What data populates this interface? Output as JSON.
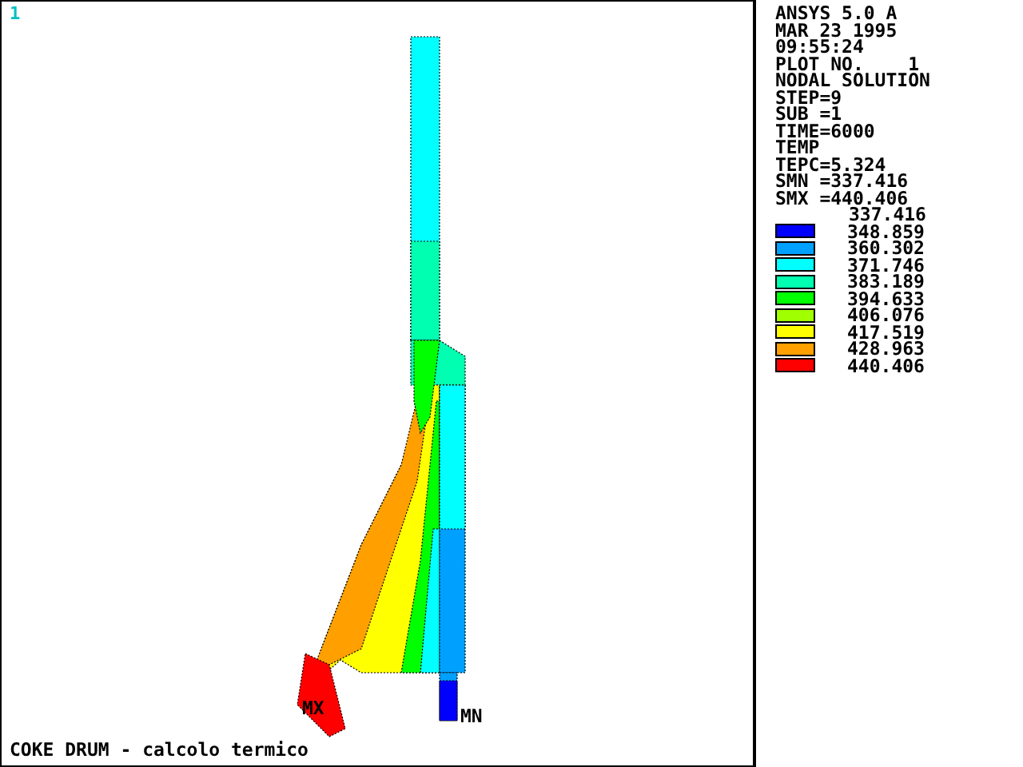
{
  "window": {
    "number": "1"
  },
  "plot": {
    "max_label": "MX",
    "min_label": "MN",
    "title": "COKE DRUM - calcolo termico"
  },
  "info": [
    "ANSYS 5.0 A",
    "MAR 23 1995",
    "09:55:24",
    "PLOT NO.    1",
    "NODAL SOLUTION",
    "STEP=9",
    "SUB =1",
    "TIME=6000",
    "TEMP",
    "TEPC=5.324",
    "SMN =337.416",
    "SMX =440.406"
  ],
  "legend": {
    "min": "337.416",
    "bands": [
      {
        "color": "#0000ff",
        "value": "348.859"
      },
      {
        "color": "#00a0ff",
        "value": "360.302"
      },
      {
        "color": "#00ffff",
        "value": "371.746"
      },
      {
        "color": "#00ffb0",
        "value": "383.189"
      },
      {
        "color": "#00ff00",
        "value": "394.633"
      },
      {
        "color": "#a0ff00",
        "value": "406.076"
      },
      {
        "color": "#ffff00",
        "value": "417.519"
      },
      {
        "color": "#ffa000",
        "value": "428.963"
      },
      {
        "color": "#ff0000",
        "value": "440.406"
      }
    ]
  }
}
